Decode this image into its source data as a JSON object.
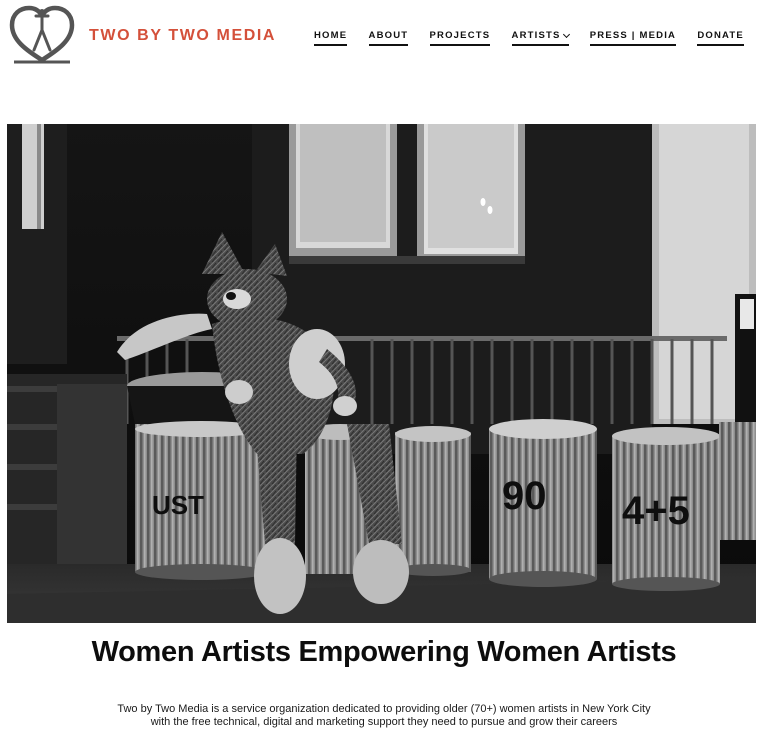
{
  "site": {
    "brand": "TWO BY TWO MEDIA",
    "logo_icon": "heart-figure-logo-icon",
    "brand_color": "#d4503a"
  },
  "nav": {
    "items": [
      {
        "label": "HOME"
      },
      {
        "label": "ABOUT"
      },
      {
        "label": "PROJECTS"
      },
      {
        "label": "ARTISTS",
        "has_dropdown": true,
        "dropdown_icon": "chevron-down-icon"
      },
      {
        "label": "PRESS | MEDIA"
      },
      {
        "label": "DONATE"
      }
    ]
  },
  "hero": {
    "description": "black-and-white-street-photo",
    "can_labels": [
      "UST",
      "90",
      "4+5"
    ]
  },
  "main": {
    "headline": "Women Artists Empowering Women Artists",
    "intro_line1": "Two by Two Media is a service organization dedicated to providing older (70+) women artists in New York City",
    "intro_line2": "with the free technical, digital and marketing support they need to pursue and grow their careers"
  }
}
